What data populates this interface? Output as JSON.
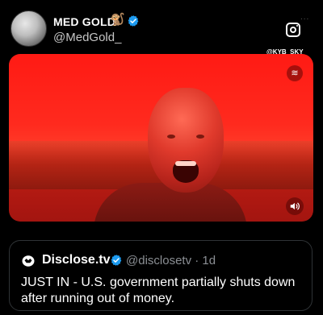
{
  "author": {
    "name": "MED GOLD",
    "emoji": "🐒",
    "handle": "@MedGold_"
  },
  "overlay": {
    "more_label": "...",
    "watermark": "@KYB_SKY"
  },
  "media": {
    "badge_label": "≋"
  },
  "quoted": {
    "name": "Disclose.tv",
    "handle": "@disclosetv · 1d",
    "text": "JUST IN - U.S. government partially shuts down after running out of money."
  },
  "icons": {
    "verified": "verified-icon",
    "instagram": "instagram-icon",
    "sound": "speaker-icon",
    "disclose_logo": "disclose-logo-icon"
  },
  "colors": {
    "background": "#000000",
    "verified": "#1d9bf0",
    "media_tint": "#ff2a1e"
  }
}
